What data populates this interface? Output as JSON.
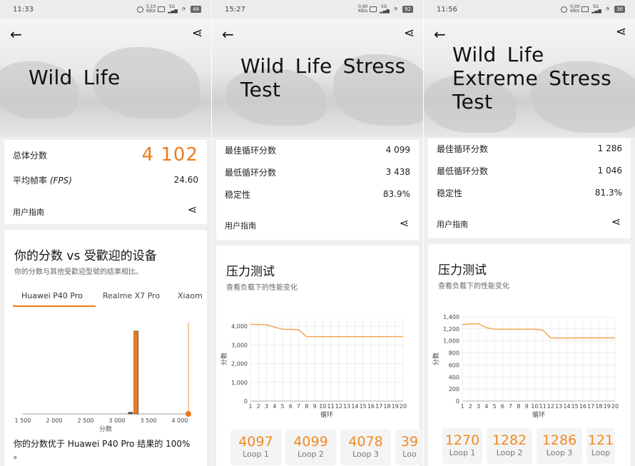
{
  "colors": {
    "accent": "#ef7a1a",
    "line": "#f2a04a",
    "grid": "#d8d8d8"
  },
  "panel1": {
    "status": {
      "time": "11:33",
      "battery": "48"
    },
    "hero": {
      "title": "Wild Life",
      "back_icon": "back-arrow-icon",
      "share_icon": "share-icon"
    },
    "score": {
      "total_label": "总体分数",
      "total_value": "4 102",
      "fps_label": "平均帧率",
      "fps_unit": "(FPS)",
      "fps_value": "24.60",
      "guide": "用户指南"
    },
    "compare": {
      "title": "你的分数 vs 受歡迎的设备",
      "subtitle": "你的分数与其他受歡迎型號的结果相比。",
      "tabs": [
        "Huawei P40 Pro",
        "Realme X7 Pro",
        "Xiaom"
      ],
      "footer": "你的分数优于 Huawei P40 Pro 结果的 100% 。",
      "chart_data": {
        "type": "bar",
        "title": "",
        "xlabel": "分数",
        "ylabel": "",
        "x_ticks": [
          "1 500",
          "2 000",
          "2 500",
          "3 000",
          "3 500",
          "4 000"
        ],
        "xlim": [
          1500,
          4000
        ],
        "bars": [
          {
            "x": 3180,
            "value": 2
          },
          {
            "x": 3270,
            "value": 100
          }
        ],
        "your_score": 4102
      }
    }
  },
  "panel2": {
    "status": {
      "time": "15:27",
      "battery": "92"
    },
    "hero": {
      "title_line1": "Wild Life Stress",
      "title_line2": "Test"
    },
    "results": [
      {
        "label": "最佳循环分数",
        "value": "4 099"
      },
      {
        "label": "最低循环分数",
        "value": "3 438"
      },
      {
        "label": "稳定性",
        "value": "83.9%"
      }
    ],
    "guide": "用户指南",
    "stress": {
      "title": "压力测试",
      "subtitle": "查看负载下的性能变化",
      "chart_data": {
        "type": "line",
        "title": "",
        "xlabel": "循环",
        "ylabel": "分数",
        "x": [
          1,
          2,
          3,
          4,
          5,
          6,
          7,
          8,
          9,
          10,
          11,
          12,
          13,
          14,
          15,
          16,
          17,
          18,
          19,
          20
        ],
        "y_ticks": [
          "0",
          "1,000",
          "2,000",
          "3,000",
          "4,000"
        ],
        "ylim": [
          0,
          4500
        ],
        "series": [
          {
            "values": [
              4097,
              4099,
              4078,
              3950,
              3840,
              3830,
              3810,
              3438,
              3440,
              3445,
              3445,
              3440,
              3445,
              3445,
              3445,
              3445,
              3445,
              3445,
              3450,
              3450
            ]
          }
        ]
      },
      "loops": [
        {
          "score": "4097",
          "label": "Loop 1"
        },
        {
          "score": "4099",
          "label": "Loop 2"
        },
        {
          "score": "4078",
          "label": "Loop 3"
        },
        {
          "score": "39",
          "label": "Loo"
        }
      ]
    }
  },
  "panel3": {
    "status": {
      "time": "11:56",
      "battery": "36"
    },
    "hero": {
      "title_line1": "Wild Life",
      "title_line2": "Extreme Stress",
      "title_line3": "Test"
    },
    "results": [
      {
        "label": "最佳循环分数",
        "value": "1 286"
      },
      {
        "label": "最低循环分数",
        "value": "1 046"
      },
      {
        "label": "稳定性",
        "value": "81.3%"
      }
    ],
    "guide": "用户指南",
    "stress": {
      "title": "压力测试",
      "subtitle": "查看负载下的性能变化",
      "chart_data": {
        "type": "line",
        "title": "",
        "xlabel": "循环",
        "ylabel": "分数",
        "x": [
          1,
          2,
          3,
          4,
          5,
          6,
          7,
          8,
          9,
          10,
          11,
          12,
          13,
          14,
          15,
          16,
          17,
          18,
          19,
          20
        ],
        "y_ticks": [
          "0",
          "200",
          "400",
          "600",
          "800",
          "1,000",
          "1,200",
          "1,400"
        ],
        "ylim": [
          0,
          1400
        ],
        "series": [
          {
            "values": [
              1270,
              1282,
              1286,
              1220,
              1195,
              1195,
              1195,
              1195,
              1195,
              1195,
              1180,
              1050,
              1046,
              1048,
              1050,
              1050,
              1050,
              1050,
              1050,
              1050
            ]
          }
        ]
      },
      "loops": [
        {
          "score": "1270",
          "label": "Loop 1"
        },
        {
          "score": "1282",
          "label": "Loop 2"
        },
        {
          "score": "1286",
          "label": "Loop 3"
        },
        {
          "score": "121",
          "label": "Loop"
        }
      ]
    }
  }
}
